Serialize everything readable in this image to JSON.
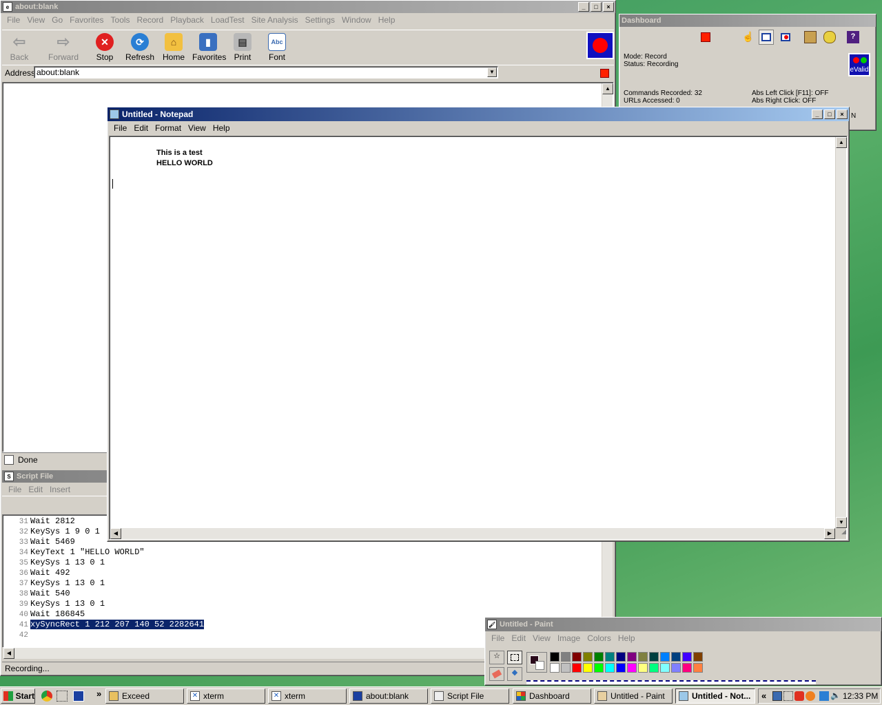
{
  "browser": {
    "title": "about:blank",
    "menu": [
      "File",
      "View",
      "Go",
      "Favorites",
      "Tools",
      "Record",
      "Playback",
      "LoadTest",
      "Site Analysis",
      "Settings",
      "Window",
      "Help"
    ],
    "toolbar": {
      "back": "Back",
      "forward": "Forward",
      "stop": "Stop",
      "refresh": "Refresh",
      "home": "Home",
      "favorites": "Favorites",
      "print": "Print",
      "font": "Font"
    },
    "address_label": "Address",
    "address_value": "about:blank",
    "status": "Done"
  },
  "dashboard": {
    "title": "Dashboard",
    "mode": "Mode: Record",
    "status": "Status: Recording",
    "commands": "Commands Recorded: 32",
    "urls": "URLs Accessed: 0",
    "abs_left": "Abs Left Click [F11]: OFF",
    "abs_right": "Abs Right Click: OFF",
    "brand": "eValid",
    "partial": "N"
  },
  "notepad": {
    "title": "Untitled - Notepad",
    "menu": [
      "File",
      "Edit",
      "Format",
      "View",
      "Help"
    ],
    "line1": "This is a test",
    "line2": "HELLO WORLD"
  },
  "script": {
    "title": "Script File",
    "menu": [
      "File",
      "Edit",
      "Insert"
    ],
    "lines": [
      {
        "n": "31",
        "text": "Wait 2812"
      },
      {
        "n": "32",
        "text": "KeySys 1 9 0 1"
      },
      {
        "n": "33",
        "text": "Wait 5469"
      },
      {
        "n": "34",
        "text": "KeyText 1 \"HELLO WORLD\""
      },
      {
        "n": "35",
        "text": "KeySys 1 13 0 1"
      },
      {
        "n": "36",
        "text": "Wait 492"
      },
      {
        "n": "37",
        "text": "KeySys 1 13 0 1"
      },
      {
        "n": "38",
        "text": "Wait 540"
      },
      {
        "n": "39",
        "text": "KeySys 1 13 0 1"
      },
      {
        "n": "40",
        "text": "Wait 186845"
      },
      {
        "n": "41",
        "text": "xySyncRect 1 212 207 140 52 2282641"
      },
      {
        "n": "42",
        "text": ""
      }
    ],
    "status": "Recording..."
  },
  "paint": {
    "title": "Untitled - Paint",
    "menu": [
      "File",
      "Edit",
      "View",
      "Image",
      "Colors",
      "Help"
    ],
    "palette_top": [
      "#000000",
      "#808080",
      "#800000",
      "#808000",
      "#008000",
      "#008080",
      "#000080",
      "#800080",
      "#808040",
      "#004040",
      "#0080ff",
      "#004080",
      "#4000ff",
      "#804000"
    ],
    "palette_bottom": [
      "#ffffff",
      "#c0c0c0",
      "#ff0000",
      "#ffff00",
      "#00ff00",
      "#00ffff",
      "#0000ff",
      "#ff00ff",
      "#ffff80",
      "#00ff80",
      "#80ffff",
      "#8080ff",
      "#ff0080",
      "#ff8040"
    ]
  },
  "taskbar": {
    "start": "Start",
    "chevron": "»",
    "tasks": [
      "Exceed",
      "xterm",
      "xterm",
      "about:blank",
      "Script File",
      "Dashboard",
      "Untitled - Paint",
      "Untitled - Not..."
    ],
    "tray_chevron": "«",
    "clock": "12:33 PM"
  }
}
